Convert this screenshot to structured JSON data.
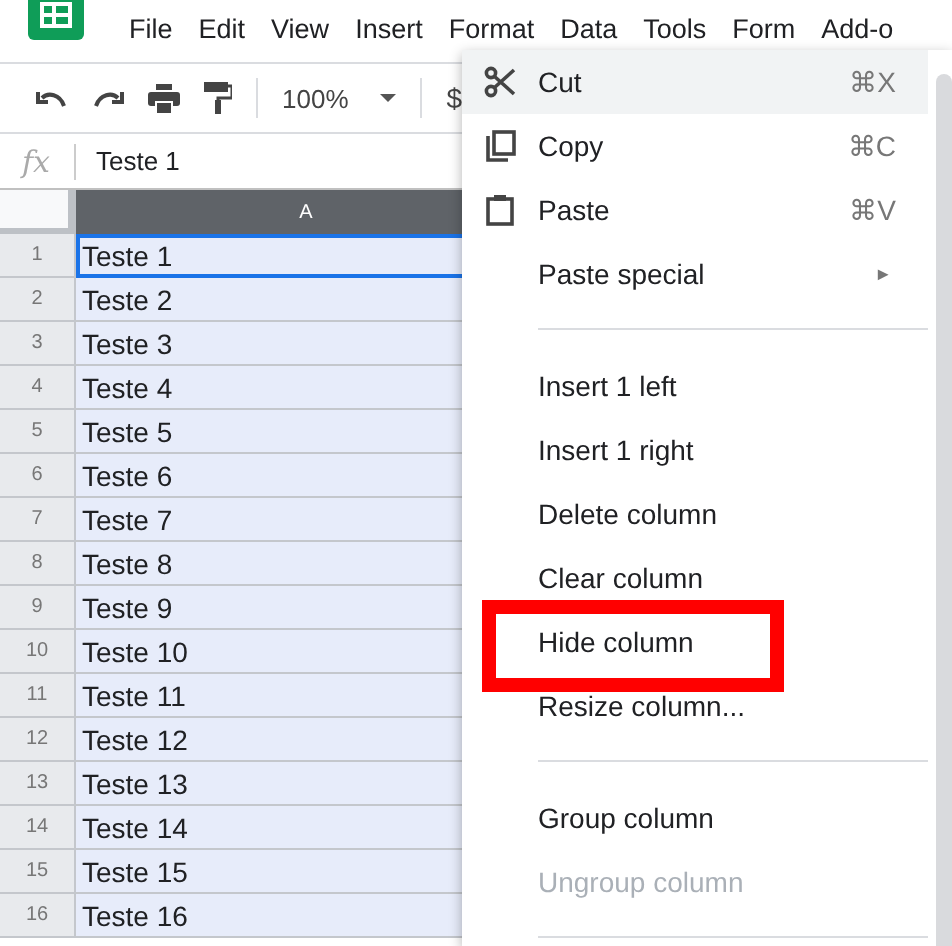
{
  "menubar": {
    "items": [
      "File",
      "Edit",
      "View",
      "Insert",
      "Format",
      "Data",
      "Tools",
      "Form",
      "Add-o"
    ]
  },
  "toolbar": {
    "zoom": "100%",
    "currency": "$"
  },
  "formula_bar": {
    "fx": "fx",
    "value": "Teste 1"
  },
  "sheet": {
    "column": {
      "label": "A",
      "selected": true
    },
    "rows": [
      {
        "number": "1",
        "value": "Teste 1",
        "active": true
      },
      {
        "number": "2",
        "value": "Teste 2",
        "active": false
      },
      {
        "number": "3",
        "value": "Teste 3",
        "active": false
      },
      {
        "number": "4",
        "value": "Teste 4",
        "active": false
      },
      {
        "number": "5",
        "value": "Teste 5",
        "active": false
      },
      {
        "number": "6",
        "value": "Teste 6",
        "active": false
      },
      {
        "number": "7",
        "value": "Teste 7",
        "active": false
      },
      {
        "number": "8",
        "value": "Teste 8",
        "active": false
      },
      {
        "number": "9",
        "value": "Teste 9",
        "active": false
      },
      {
        "number": "10",
        "value": "Teste 10",
        "active": false
      },
      {
        "number": "11",
        "value": "Teste 11",
        "active": false
      },
      {
        "number": "12",
        "value": "Teste 12",
        "active": false
      },
      {
        "number": "13",
        "value": "Teste 13",
        "active": false
      },
      {
        "number": "14",
        "value": "Teste 14",
        "active": false
      },
      {
        "number": "15",
        "value": "Teste 15",
        "active": false
      },
      {
        "number": "16",
        "value": "Teste 16",
        "active": false
      }
    ]
  },
  "context_menu": {
    "items": [
      {
        "kind": "cut",
        "label": "Cut",
        "shortcut": "⌘X",
        "hovered": true,
        "disabled": false,
        "annotated": false
      },
      {
        "kind": "copy",
        "label": "Copy",
        "shortcut": "⌘C",
        "hovered": false,
        "disabled": false,
        "annotated": false
      },
      {
        "kind": "paste",
        "label": "Paste",
        "shortcut": "⌘V",
        "hovered": false,
        "disabled": false,
        "annotated": false
      },
      {
        "kind": "submenu",
        "label": "Paste special",
        "arrow": "►",
        "hovered": false,
        "disabled": false,
        "annotated": false
      },
      {
        "kind": "separator"
      },
      {
        "kind": "item",
        "label": "Insert 1 left",
        "hovered": false,
        "disabled": false,
        "annotated": false
      },
      {
        "kind": "item",
        "label": "Insert 1 right",
        "hovered": false,
        "disabled": false,
        "annotated": false
      },
      {
        "kind": "item",
        "label": "Delete column",
        "hovered": false,
        "disabled": false,
        "annotated": false
      },
      {
        "kind": "item",
        "label": "Clear column",
        "hovered": false,
        "disabled": false,
        "annotated": false
      },
      {
        "kind": "item",
        "label": "Hide column",
        "hovered": false,
        "disabled": false,
        "annotated": true
      },
      {
        "kind": "item",
        "label": "Resize column...",
        "hovered": false,
        "disabled": false,
        "annotated": false
      },
      {
        "kind": "separator"
      },
      {
        "kind": "item",
        "label": "Group column",
        "hovered": false,
        "disabled": false,
        "annotated": false
      },
      {
        "kind": "item",
        "label": "Ungroup column",
        "hovered": false,
        "disabled": true,
        "annotated": false
      },
      {
        "kind": "separator"
      }
    ]
  }
}
